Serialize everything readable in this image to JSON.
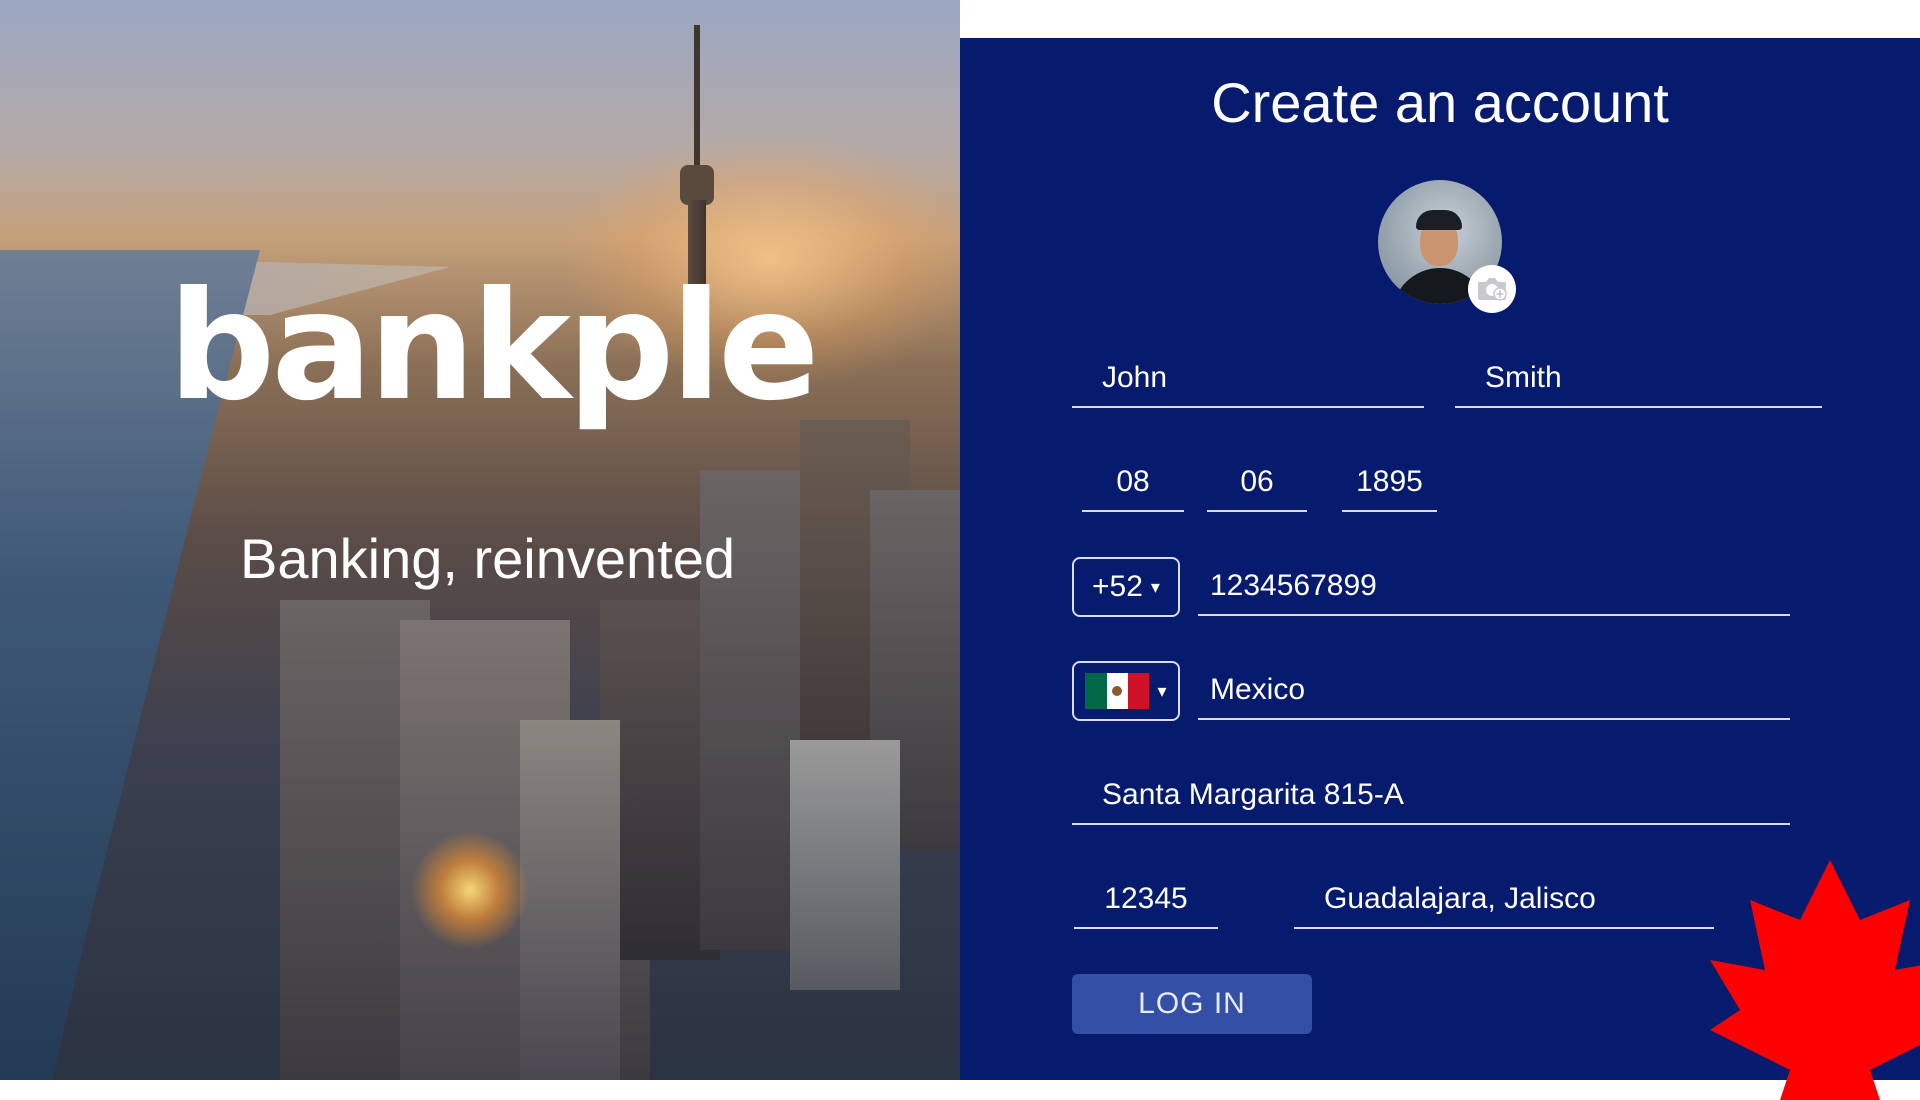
{
  "brand": {
    "name": "bankple",
    "tagline": "Banking, reinvented"
  },
  "form": {
    "title": "Create an account",
    "first_name": "John",
    "last_name": "Smith",
    "birth_day": "08",
    "birth_month": "06",
    "birth_year": "1895",
    "phone_code": "+52",
    "phone_number": "1234567899",
    "country": "Mexico",
    "address": "Santa Margarita 815-A",
    "zip": "12345",
    "city": "Guadalajara, Jalisco",
    "submit_label": "LOG IN"
  },
  "icons": {
    "caret": "▾",
    "camera": "camera-add-icon",
    "flag": "mexico-flag-icon",
    "decoration": "maple-leaf-icon"
  },
  "colors": {
    "panel_bg": "#061a6e",
    "button_bg": "#334fa6",
    "maple_leaf": "#ff0000",
    "field_line": "#d7dcef"
  }
}
